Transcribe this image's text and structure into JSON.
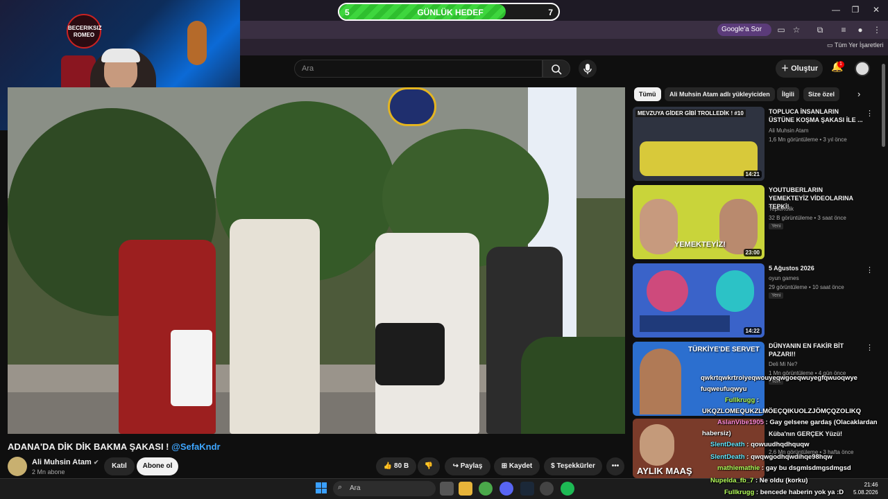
{
  "goal": {
    "start": "5",
    "label": "GÜNLÜK HEDEF",
    "end": "7",
    "progress": 0.76
  },
  "webcam": {
    "logo_text": "BECERIKSIZ ROMEO"
  },
  "browser": {
    "google_ask": "Google'a Sor",
    "bookmarks_all": "Tüm Yer İşaretleri",
    "window_controls": [
      "—",
      "❐",
      "✕"
    ]
  },
  "youtube_header": {
    "search_placeholder": "Ara",
    "create_label": "Oluştur",
    "notifications_count": "1"
  },
  "video": {
    "title": "ADANA'DA DİK DİK BAKMA ŞAKASI !",
    "title_mention": "@SefaKndr",
    "channel": "Ali Muhsin Atam",
    "subscribers": "2 Mn abone",
    "join_label": "Katıl",
    "subscribe_label": "Abone ol",
    "likes": "80 B",
    "share_label": "Paylaş",
    "save_label": "Kaydet",
    "thanks_label": "Teşekkürler",
    "more_label": "•••"
  },
  "chips": [
    "Tümü",
    "Ali Muhsin Atam adlı yükleyiciden",
    "İlgili",
    "Size özel"
  ],
  "recommendations": [
    {
      "title": "TOPLUCA İNSANLARIN ÜSTÜNE KOŞMA ŞAKASI İLE ...",
      "channel": "Ali Muhsin Atam",
      "meta": "1,6 Mn görüntüleme • 3 yıl önce",
      "duration": "14:21",
      "badge": "",
      "thumb_text": "MEVZUYA GİDER GİBİ TROLLEDİK ! #10"
    },
    {
      "title": "YOUTUBERLARIN YEMEKTEYİZ VİDEOLARINA TEPKİ!",
      "channel": "TepkiKolik",
      "meta": "32 B görüntüleme • 3 saat önce",
      "duration": "23:00",
      "badge": "Yeni",
      "thumb_text": "YEMEKTEYİZ!"
    },
    {
      "title": "5 Ağustos 2026",
      "channel": "oyun games",
      "meta": "29 görüntüleme • 10 saat önce",
      "duration": "14:22",
      "badge": "Yeni",
      "thumb_text": ""
    },
    {
      "title": "DÜNYANIN EN FAKİR BİT PAZARI!!",
      "channel": "Deli Mi Ne?",
      "meta": "1 Mn görüntüleme • 4 gün önce",
      "duration": "",
      "badge": "Yeni",
      "thumb_text": "TÜRKİYE'DE SERVET"
    },
    {
      "title": "Küba'nın GERÇEK Yüzü!",
      "channel": "",
      "meta": "2,6 Mn görüntüleme • 3 hafta önce",
      "duration": "",
      "badge": "",
      "thumb_text": "AYLIK MAAŞ"
    }
  ],
  "chat": [
    {
      "user": "",
      "text": "qwkrtqwkrtroiyeqwouyeqwgoeqwuyegfqwuoqwye"
    },
    {
      "user": "",
      "text": "fuqweufuqwyu"
    },
    {
      "user": "Fullkrugg",
      "text": ":"
    },
    {
      "user": "",
      "text": "UKQZLOMEQUKZLMÖEÇQIKUOLZJÖMÇQZOLIKQ"
    },
    {
      "user": "AslanVibe1905",
      "text": ": Gay gelsene gardaş (Olacaklardan"
    },
    {
      "user": "",
      "text": "habersiz)"
    },
    {
      "user": "SlentDeath",
      "text": ": qowuudhqdhquqw"
    },
    {
      "user": "SlentDeath",
      "text": ": qwqwgodhqwdihqe98hqw"
    },
    {
      "user": "mathiemathie",
      "text": ": gay bu dsgmlsdmgsdmgsd"
    },
    {
      "user": "Nupelda_fb_7",
      "text": ": Ne oldu (korku)"
    },
    {
      "user": "Fullkrugg",
      "text": ": bencede haberin yok ya :D"
    }
  ],
  "taskbar": {
    "search": "Ara",
    "time": "21:46",
    "date": "5.08.2026"
  }
}
